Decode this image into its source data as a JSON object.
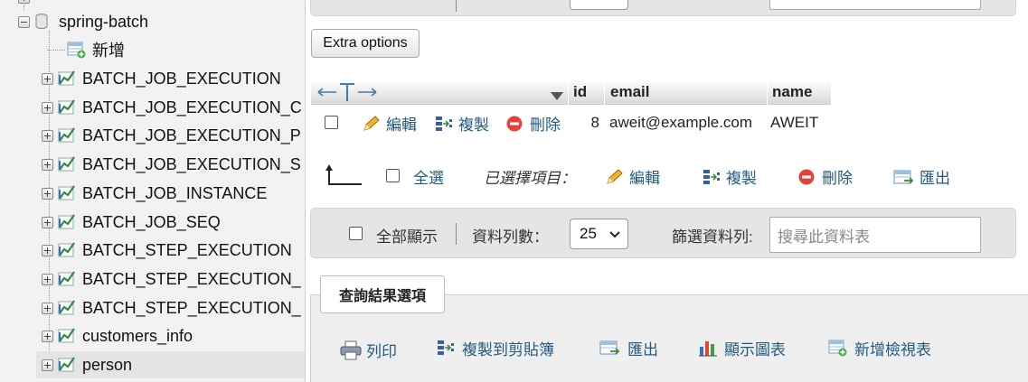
{
  "nav": {
    "db_name": "spring-batch",
    "new_label": "新增",
    "tables": [
      "BATCH_JOB_EXECUTION",
      "BATCH_JOB_EXECUTION_C",
      "BATCH_JOB_EXECUTION_P",
      "BATCH_JOB_EXECUTION_S",
      "BATCH_JOB_INSTANCE",
      "BATCH_JOB_SEQ",
      "BATCH_STEP_EXECUTION",
      "BATCH_STEP_EXECUTION_",
      "BATCH_STEP_EXECUTION_",
      "customers_info",
      "person"
    ],
    "selected_table": "person"
  },
  "results": {
    "extra_options_label": "Extra options",
    "columns": [
      "id",
      "email",
      "name"
    ],
    "row": {
      "edit_label": "編輯",
      "copy_label": "複製",
      "delete_label": "刪除",
      "id": "8",
      "email": "aweit@example.com",
      "name": "AWEIT"
    },
    "with_selected": {
      "check_all_label": "全選",
      "selected_label": "已選擇項目：",
      "edit_label": "編輯",
      "copy_label": "複製",
      "delete_label": "刪除",
      "export_label": "匯出"
    },
    "nav_bar": {
      "show_all_label": "全部顯示",
      "rows_label": "資料列數：",
      "rows_value": "25",
      "filter_label": "篩選資料列:",
      "filter_placeholder": "搜尋此資料表"
    }
  },
  "query_ops": {
    "legend": "查詢結果選項",
    "print_label": "列印",
    "copy_clipboard_label": "複製到剪貼簿",
    "export_label": "匯出",
    "chart_label": "顯示圖表",
    "create_view_label": "新增檢視表"
  },
  "colors": {
    "link": "#235a81",
    "delete_red": "#e0443a",
    "panel_grey": "#e5e5e5"
  }
}
